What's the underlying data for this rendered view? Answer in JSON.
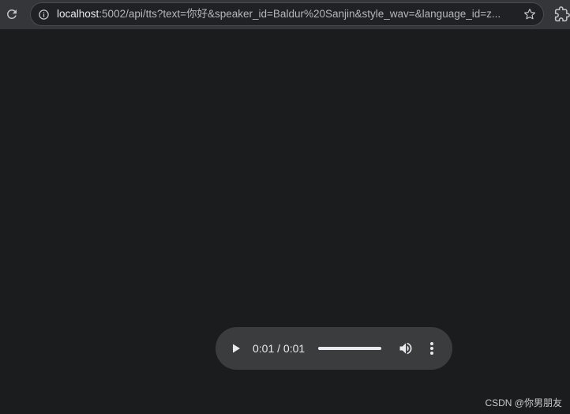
{
  "browser": {
    "url_host": "localhost",
    "url_rest": ":5002/api/tts?text=你好&speaker_id=Baldur%20Sanjin&style_wav=&language_id=z...",
    "icons": {
      "reload": "reload-icon",
      "info": "info-icon",
      "bookmark": "star-icon",
      "extensions": "puzzle-icon"
    }
  },
  "audio_player": {
    "time_display": "0:01 / 0:01",
    "progress_fraction": 1.0,
    "icons": {
      "play": "play-icon",
      "volume": "volume-icon",
      "more": "more-options-icon"
    }
  },
  "watermark": "CSDN @你男朋友",
  "colors": {
    "page_background": "#1b1c1e",
    "toolbar": "#35363a",
    "player_background": "#3b3c3e",
    "player_foreground": "#e8eaed"
  }
}
